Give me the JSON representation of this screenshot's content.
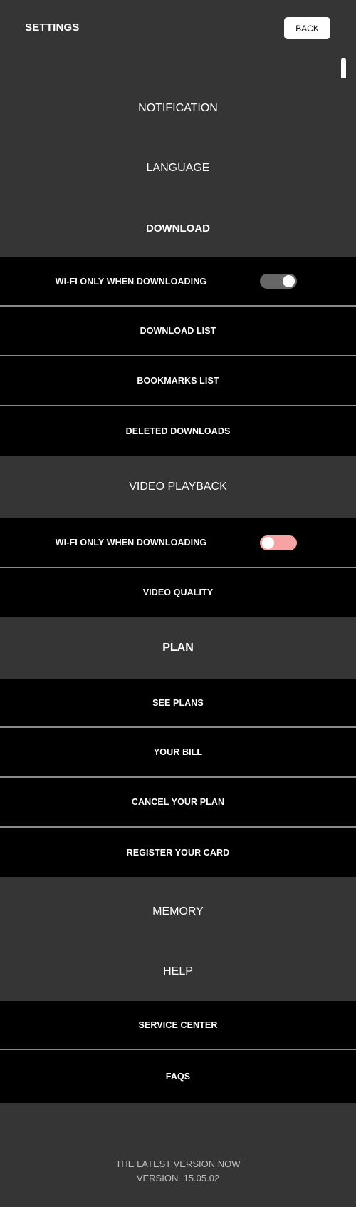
{
  "header": {
    "title": "SETTINGS",
    "back_label": "BACK"
  },
  "sections": {
    "notification": "NOTIFICATION",
    "language": "LANGUAGE",
    "download": "DOWNLOAD",
    "video_playback": "VIDEO PLAYBACK",
    "plan": "PLAN",
    "memory": "MEMORY",
    "help": "HELP"
  },
  "download": {
    "wifi_only": {
      "label": "WI-FI ONLY WHEN DOWNLOADING",
      "enabled": true
    },
    "download_list": "DOWNLOAD LIST",
    "bookmarks_list": "BOOKMARKS LIST",
    "deleted_downloads": "DELETED DOWNLOADS"
  },
  "video_playback": {
    "wifi_only": {
      "label": "WI-FI ONLY WHEN DOWNLOADING",
      "enabled": false
    },
    "video_quality": "VIDEO QUALITY"
  },
  "plan": {
    "see_plans": "SEE PLANS",
    "your_bill": "YOUR BILL",
    "cancel_plan": "CANCEL YOUR PLAN",
    "register_card": "REGISTER YOUR CARD"
  },
  "help": {
    "service_center": "SERVICE CENTER",
    "faqs": "FAQS"
  },
  "footer": {
    "latest": "THE LATEST VERSION NOW",
    "version": "VERSION  15.05.02"
  },
  "colors": {
    "background": "#353535",
    "row_background": "#000000",
    "toggle_on": "#666666",
    "toggle_off": "#f7a3a3"
  }
}
